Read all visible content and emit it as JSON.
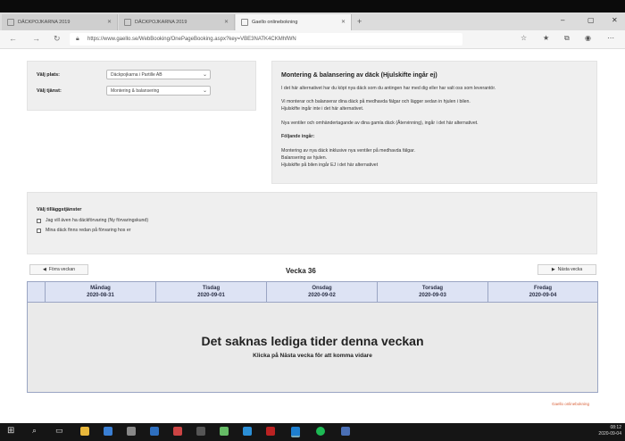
{
  "browser": {
    "tabs": [
      {
        "label": "DÄCKPOJKARNA 2019",
        "active": false
      },
      {
        "label": "DÄCKPOJKARNA 2019",
        "active": false
      },
      {
        "label": "Gaello onlinebokning",
        "active": true
      }
    ],
    "url": "https://www.gaello.se/WebBooking/OnePageBooking.aspx?key=VBE3NATK4CKMhfWN"
  },
  "booking": {
    "location_label": "Välj plats:",
    "location_value": "Däckpojkarna i Partille AB",
    "service_label": "Välj tjänst:",
    "service_value": "Montering & balansering"
  },
  "info": {
    "title": "Montering & balansering av däck (Hjulskifte ingår ej)",
    "para1": "I det här alternativet har du köpt nya däck som du antingen har med dig eller har valt oss som leverantör.",
    "para2": "Vi monterar och balanserar dina däck på medhavda fälgar och lägger sedan in hjulen i bilen.",
    "para3": "Hjulskifte ingår inte i det här alternativet.",
    "para4": "Nya ventiler och omhändertagande av dina gamla däck (Återvinning), ingår i det här alternativet.",
    "included_title": "Följande ingår:",
    "inc1": "Montering av nya däck inklusive nya ventiler på medhavda fälgar.",
    "inc2": "Balansering av hjulen.",
    "inc3": "Hjulskifte på bilen ingår EJ i det här alternativet"
  },
  "addons": {
    "title": "Välj tilläggstjänster",
    "opt1": "Jag vill även ha däckförvaring (Ny förvaringskund)",
    "opt2": "Mina däck finns redan på förvaring hos er"
  },
  "week": {
    "prev_label": "Förra veckan",
    "title": "Vecka 36",
    "next_label": "Nästa vecka",
    "days": [
      {
        "name": "Måndag",
        "date": "2020-08-31"
      },
      {
        "name": "Tisdag",
        "date": "2020-09-01"
      },
      {
        "name": "Onsdag",
        "date": "2020-09-02"
      },
      {
        "name": "Torsdag",
        "date": "2020-09-03"
      },
      {
        "name": "Fredag",
        "date": "2020-09-04"
      }
    ],
    "empty_title": "Det saknas lediga tider denna veckan",
    "empty_sub": "Klicka på Nästa vecka för att komma vidare"
  },
  "footer": {
    "link": "Gaello onlinebokning"
  },
  "taskbar": {
    "time": "08:12",
    "date": "2020-09-04"
  },
  "colors": {
    "panel_bg": "#efefef",
    "grid_header": "#dde3f4",
    "accent_link": "#d9623a"
  }
}
